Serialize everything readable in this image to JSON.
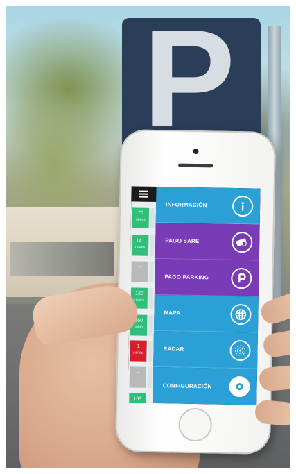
{
  "background": {
    "sign_letter": "P"
  },
  "app": {
    "side_panel": {
      "menu_icon": "hamburger-menu-icon",
      "chips": [
        {
          "count": "70",
          "label": "LIBRES",
          "color": "#2fbf7a"
        },
        {
          "count": "141",
          "label": "LIBRES",
          "color": "#2fbf7a"
        },
        {
          "count": "--",
          "label": "",
          "color": "#b9b9b9"
        },
        {
          "count": "120",
          "label": "LIBRES",
          "color": "#2fbf7a"
        },
        {
          "count": "260",
          "label": "LIBRES",
          "color": "#2fbf7a"
        },
        {
          "count": "1",
          "label": "LIBRES",
          "color": "#d3202a"
        },
        {
          "count": "--",
          "label": "",
          "color": "#b9b9b9"
        },
        {
          "count": "103",
          "label": "",
          "color": "#2fbf7a"
        }
      ]
    },
    "menu": {
      "items": [
        {
          "label": "INFORMACIÓN",
          "icon": "info-icon",
          "color": "#2aa0d7"
        },
        {
          "label": "PAGO SARE",
          "icon": "ticket-payment-icon",
          "color": "#7a3bb7"
        },
        {
          "label": "PAGO PARKING",
          "icon": "parking-p-icon",
          "color": "#7a3bb7"
        },
        {
          "label": "MAPA",
          "icon": "map-icon",
          "color": "#2aa0d7"
        },
        {
          "label": "RADAR",
          "icon": "radar-icon",
          "color": "#2aa0d7"
        },
        {
          "label": "CONFIGURACIÓN",
          "icon": "settings-gear-icon",
          "color": "#2aa0d7"
        }
      ]
    }
  }
}
